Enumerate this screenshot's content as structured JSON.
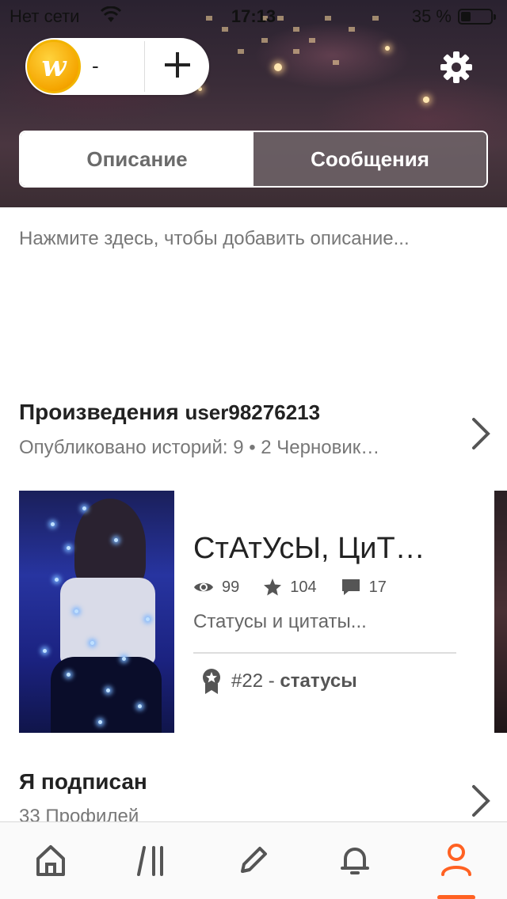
{
  "status_bar": {
    "carrier": "Нет сети",
    "time": "17:13",
    "battery": "35 %"
  },
  "wallet": {
    "coin_letter": "w",
    "coin_count": "-"
  },
  "segments": {
    "description_tab": "Описание",
    "messages_tab": "Сообщения",
    "active": "messages_tab"
  },
  "description_placeholder": "Нажмите здесь, чтобы добавить описание...",
  "works": {
    "title": "Произведения",
    "username": "user98276213",
    "subtitle": "Опубликовано историй: 9 • 2 Черновик…"
  },
  "story": {
    "title": "СтАтУсЫ, ЦиТ…",
    "views": "99",
    "votes": "104",
    "comments": "17",
    "description": "Статусы и цитаты...",
    "rank": "#22",
    "rank_separator": " - ",
    "rank_tag": "статусы"
  },
  "following": {
    "title": "Я подписан",
    "subtitle": "33 Профилей"
  },
  "tabbar": {
    "active": "profile",
    "accent": "#ff6122"
  }
}
